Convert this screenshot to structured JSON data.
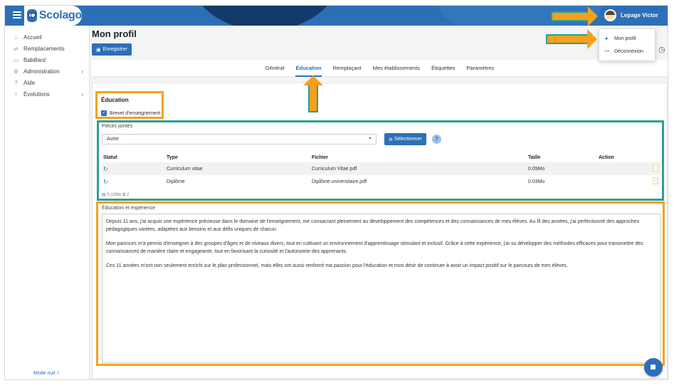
{
  "app": {
    "name": "Scolago"
  },
  "user": {
    "name": "Lepage Victor"
  },
  "user_menu": {
    "items": [
      {
        "icon": "user-icon",
        "label": "Mon profil"
      },
      {
        "icon": "logout-icon",
        "label": "Déconnexion"
      }
    ]
  },
  "sidebar": {
    "items": [
      {
        "icon": "home-icon",
        "label": "Accueil"
      },
      {
        "icon": "replace-icon",
        "label": "Remplacements"
      },
      {
        "icon": "chat-icon",
        "label": "Babillard"
      },
      {
        "icon": "gear-icon",
        "label": "Administration",
        "chevron": "›"
      },
      {
        "icon": "question-icon",
        "label": "Aide"
      },
      {
        "icon": "sprout-icon",
        "label": "Évolutions",
        "chevron": "›"
      }
    ],
    "night_mode": "Mode nuit ☾"
  },
  "page": {
    "title": "Mon profil",
    "save_label": "Enregistrer"
  },
  "tabs": [
    {
      "label": "Général"
    },
    {
      "label": "Éducation",
      "active": true
    },
    {
      "label": "Remplaçant"
    },
    {
      "label": "Mes établissements"
    },
    {
      "label": "Étiquettes"
    },
    {
      "label": "Paramètres"
    }
  ],
  "education": {
    "title": "Éducation",
    "checkbox_label": "Brevet d'enseignement",
    "checkbox_checked": true
  },
  "attachments": {
    "label": "Pièces jointes",
    "select_value": "Autre",
    "select_button": "Sélectionner",
    "help": "?",
    "columns": [
      "Statut",
      "Type",
      "Fichier",
      "Taille",
      "Action"
    ],
    "rows": [
      {
        "type": "Curriculum vitae",
        "file": "Curriculum Vitae.pdf",
        "size": "0.09Mo"
      },
      {
        "type": "Diplôme",
        "file": "Diplôme universitaire.pdf",
        "size": "0.03Mo"
      }
    ],
    "summary": "0.12Mo",
    "summary_count": "2"
  },
  "experience": {
    "label": "Éducation et expérience",
    "paragraphs": [
      "Depuis 11 ans, j'ai acquis une expérience précieuse dans le domaine de l'enseignement, me consacrant pleinement au développement des compétences et des connaissances de mes élèves. Au fil des années, j'ai perfectionné des approches pédagogiques variées, adaptées aux besoins et aux défis uniques de chacun.",
      "Mon parcours m'a permis d'enseigner à des groupes d'âges et de niveaux divers, tout en cultivant un environnement d'apprentissage stimulant et inclusif. Grâce à cette expérience, j'ai su développer des méthodes efficaces pour transmettre des connaissances de manière claire et engageante, tout en favorisant la curiosité et l'autonomie des apprenants.",
      "Ces 11 années m'ont non seulement enrichi sur le plan professionnel, mais elles ont aussi renforcé ma passion pour l'éducation et mon désir de continuer à avoir un impact positif sur le parcours de mes élèves."
    ]
  },
  "colors": {
    "brand": "#2d6fb7",
    "highlight_orange": "#f3a31a",
    "highlight_teal": "#2e9e96"
  }
}
